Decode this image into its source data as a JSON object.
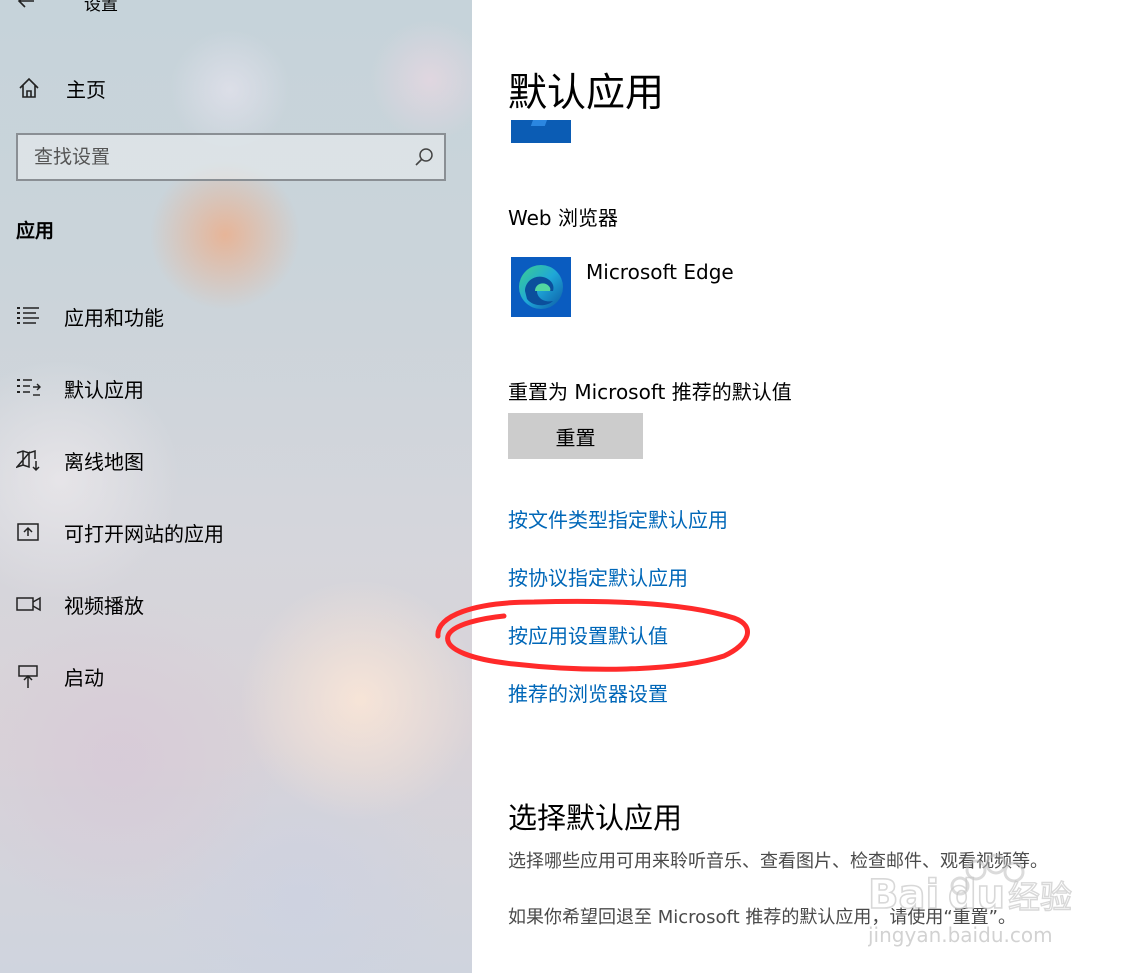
{
  "window": {
    "title": "设置"
  },
  "sidebar": {
    "home_label": "主页",
    "search_placeholder": "查找设置",
    "section_title": "应用",
    "items": [
      {
        "label": "应用和功能",
        "icon": "list-icon"
      },
      {
        "label": "默认应用",
        "icon": "default-apps-icon"
      },
      {
        "label": "离线地图",
        "icon": "map-download-icon"
      },
      {
        "label": "可打开网站的应用",
        "icon": "open-link-icon"
      },
      {
        "label": "视频播放",
        "icon": "video-camera-icon"
      },
      {
        "label": "启动",
        "icon": "startup-icon"
      }
    ]
  },
  "main": {
    "title": "默认应用",
    "web_browser_heading": "Web 浏览器",
    "web_browser_app": "Microsoft Edge",
    "reset_heading": "重置为 Microsoft 推荐的默认值",
    "reset_button": "重置",
    "links": [
      "按文件类型指定默认应用",
      "按协议指定默认应用",
      "按应用设置默认值",
      "推荐的浏览器设置"
    ],
    "choose_heading": "选择默认应用",
    "desc1": "选择哪些应用可用来聆听音乐、查看图片、检查邮件、观看视频等。",
    "desc2": "如果你希望回退至 Microsoft 推荐的默认应用，请使用“重置”。"
  },
  "watermark": {
    "brand": "Baidu经验",
    "url": "jingyan.baidu.com"
  },
  "colors": {
    "link": "#0067b8",
    "button": "#cccccc",
    "annotation": "#ff2a2a",
    "edge_tile": "#0a5cc0"
  }
}
